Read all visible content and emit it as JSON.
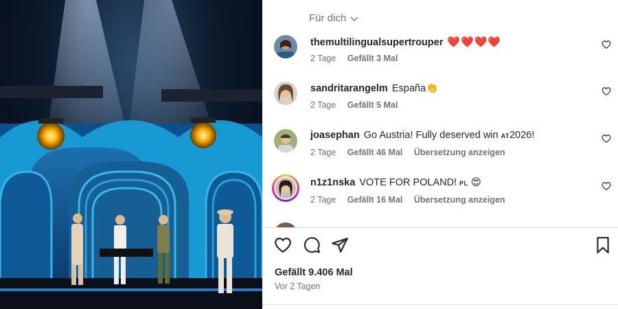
{
  "feed_selector": {
    "label": "Für dich",
    "icon": "chevron-down-icon"
  },
  "comments": [
    {
      "username": "themultilingualsupertrouper",
      "text": "",
      "emoji": "❤️❤️❤️❤️",
      "time": "2 Tage",
      "likes": "Gefällt 3 Mal",
      "translate": ""
    },
    {
      "username": "sandritarangelm",
      "text": "España",
      "emoji": "👏",
      "time": "2 Tage",
      "likes": "Gefällt 5 Mal",
      "translate": ""
    },
    {
      "username": "joasephan",
      "text": "Go Austria! Fully deserved win ",
      "flag": "AT",
      "text2": "2026!",
      "time": "2 Tage",
      "likes": "Gefällt 46 Mal",
      "translate": "Übersetzung anzeigen"
    },
    {
      "username": "n1z1nska",
      "text": "VOTE FOR POLAND! ",
      "flag": "PL",
      "emoji": "😍",
      "time": "2 Tage",
      "likes": "Gefällt 16 Mal",
      "translate": "Übersetzung anzeigen"
    }
  ],
  "post": {
    "likes": "Gefällt 9.406 Mal",
    "date": "Vor 2 Tagen"
  },
  "icons": {
    "like": "heart-icon",
    "comment": "comment-icon",
    "share": "share-icon",
    "save": "bookmark-icon"
  },
  "colors": {
    "heart": "#ed1c24",
    "muted": "#737373",
    "text": "#262626",
    "divider": "#dbdbdb"
  }
}
